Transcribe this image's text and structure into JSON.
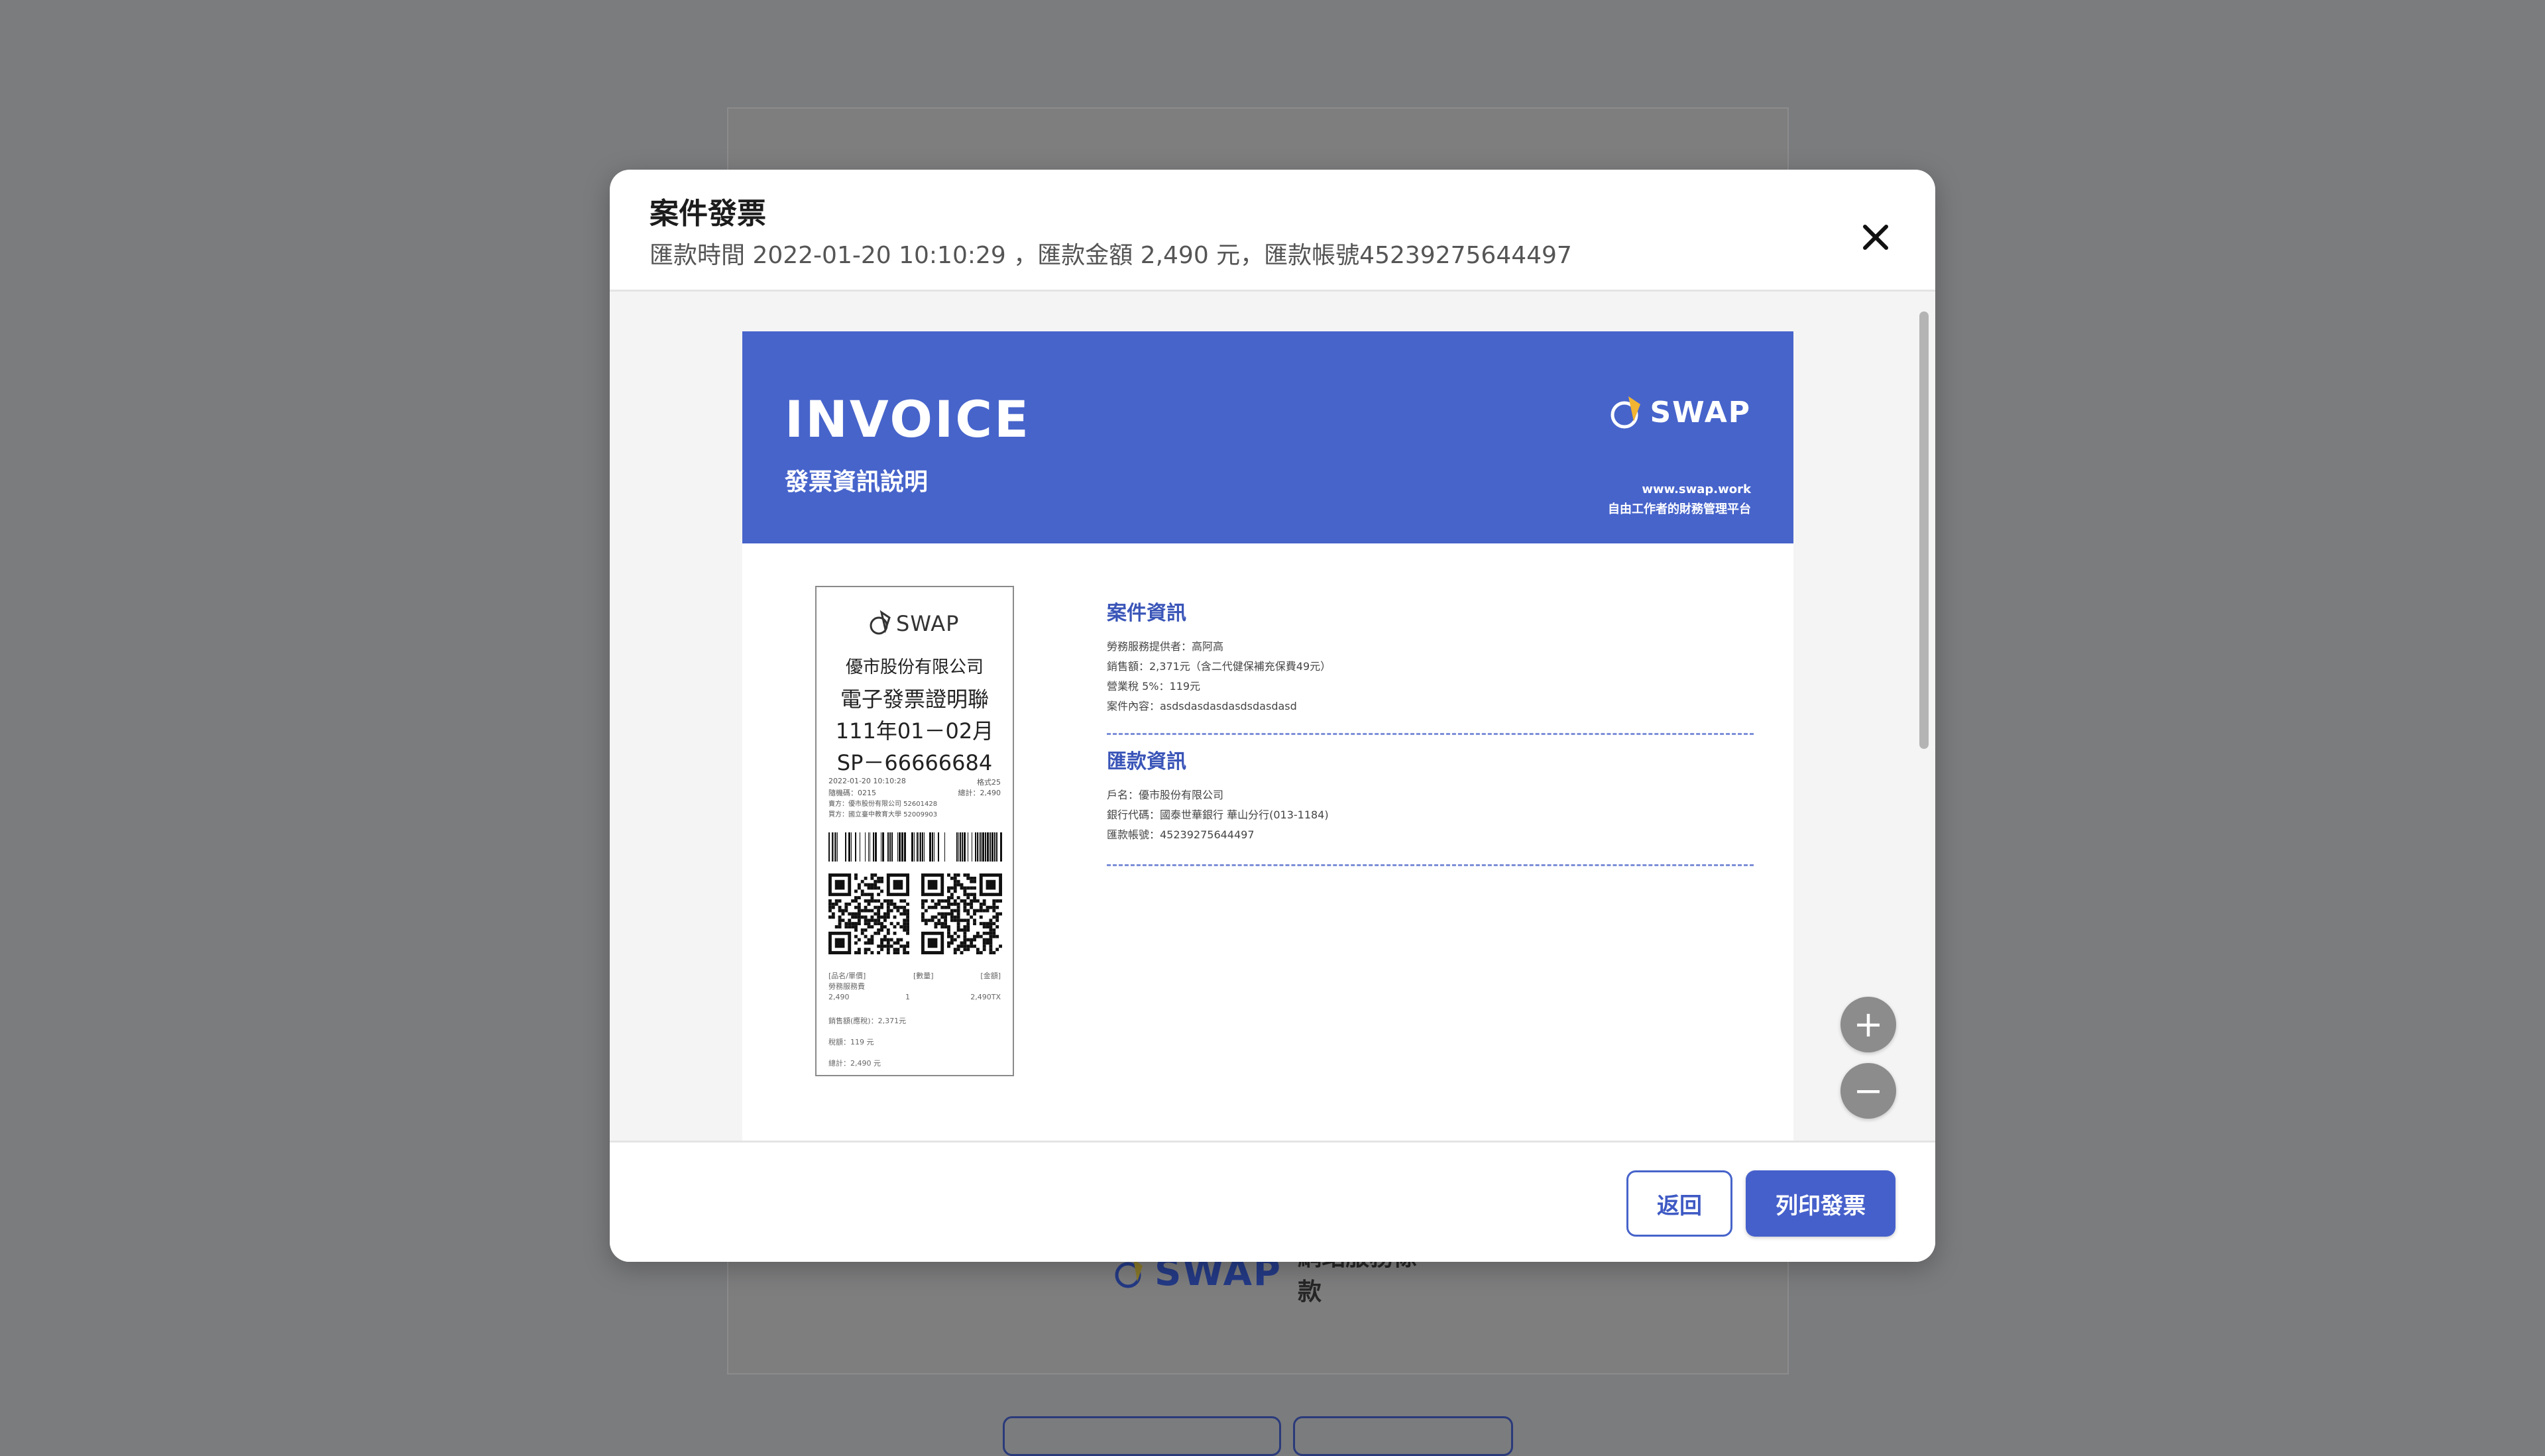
{
  "background": {
    "logo_text": "SWAP",
    "terms_text": "網站服務條款"
  },
  "modal": {
    "title": "案件發票",
    "subtitle": "匯款時間 2022-01-20 10:10:29 ，匯款金額 2,490 元，匯款帳號45239275644497",
    "close_icon": "close-icon"
  },
  "invoice": {
    "title": "INVOICE",
    "subtitle": "發票資訊說明",
    "logo_text": "SWAP",
    "url": "www.swap.work",
    "tagline": "自由工作者的財務管理平台",
    "accent_color": "#4764cb"
  },
  "receipt": {
    "logo_text": "SWAP",
    "company": "優市股份有限公司",
    "doc_title": "電子發票證明聯",
    "period": "111年01－02月",
    "number": "SP－66666684",
    "datetime": "2022-01-20 10:10:28",
    "format": "格式25",
    "random_code": "隨機碼：0215",
    "total_short": "總計：2,490",
    "seller": "賣方：優市股份有限公司 52601428",
    "buyer": "買方：國立臺中教育大學 52009903",
    "col_item": "[品名/單價]",
    "col_qty": "[數量]",
    "col_amount": "[金額]",
    "item_name": "勞務服務費",
    "item_price": "2,490",
    "item_qty": "1",
    "item_amount": "2,490TX",
    "sales_excl_tax": "銷售額(應稅)：2,371元",
    "tax": "稅額：119 元",
    "total": "總計：2,490 元"
  },
  "case_info": {
    "title": "案件資訊",
    "lines": [
      "勞務服務提供者：高阿高",
      "銷售額：2,371元（含二代健保補充保費49元）",
      "營業稅 5%：119元",
      "案件內容：asdsdasdasdasdsdasdasd"
    ]
  },
  "payment_info": {
    "title": "匯款資訊",
    "lines": [
      "戶名：優市股份有限公司",
      "銀行代碼：國泰世華銀行 華山分行(013-1184)",
      "匯款帳號：45239275644497"
    ]
  },
  "zoom": {
    "in_label": "+",
    "out_label": "−"
  },
  "footer": {
    "back_label": "返回",
    "print_label": "列印發票"
  }
}
